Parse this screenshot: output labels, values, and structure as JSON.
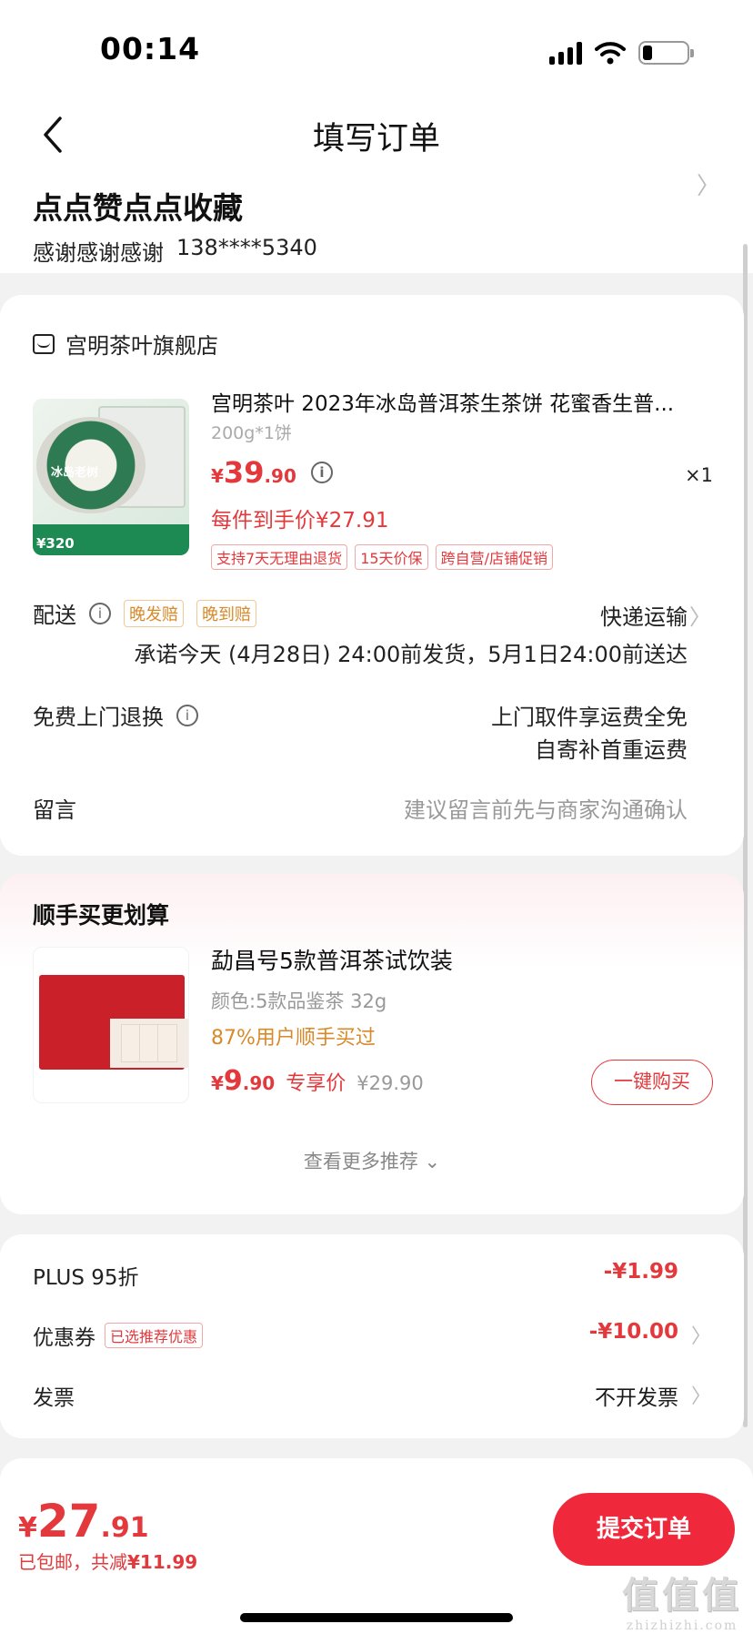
{
  "status_bar": {
    "time": "00:14"
  },
  "nav": {
    "title": "填写订单"
  },
  "address": {
    "name": "点点赞点点收藏",
    "contact_name": "感谢感谢感谢",
    "phone": "138****5340"
  },
  "shop": {
    "name": "宫明茶叶旗舰店"
  },
  "product": {
    "title": "宫明茶叶 2023年冰岛普洱茶生茶饼 花蜜香生普...",
    "spec": "200g*1饼",
    "price_yen": "¥",
    "price_int": "39",
    "price_dec": ".90",
    "quantity": "×1",
    "unit_price": "每件到手价¥27.91",
    "tags": [
      "支持7天无理由退货",
      "15天价保",
      "跨自营/店铺促销"
    ],
    "image_text": {
      "label": "冰岛老树",
      "price": "¥320"
    }
  },
  "delivery": {
    "label": "配送",
    "tags": [
      "晚发赔",
      "晚到赔"
    ],
    "method": "快递运输",
    "promise": "承诺今天 (4月28日) 24:00前发货，5月1日24:00前送达"
  },
  "return_service": {
    "label": "免费上门退换",
    "line1": "上门取件享运费全免",
    "line2": "自寄补首重运费"
  },
  "message": {
    "label": "留言",
    "placeholder": "建议留言前先与商家沟通确认"
  },
  "recommend": {
    "title": "顺手买更划算",
    "item": {
      "title": "勐昌号5款普洱茶试饮装",
      "spec": "颜色:5款品鉴茶 32g",
      "social": "87%用户顺手买过",
      "price_yen": "¥",
      "price_int": "9",
      "price_dec": ".90",
      "price_label": "专享价",
      "original_price": "¥29.90",
      "buy_label": "一键购买"
    },
    "more_label": "查看更多推荐 ⌄"
  },
  "discounts": [
    {
      "label": "PLUS 95折",
      "value": "-¥1.99"
    },
    {
      "label": "优惠券",
      "tag": "已选推荐优惠",
      "value": "-¥10.00"
    },
    {
      "label": "发票",
      "value": "不开发票"
    }
  ],
  "footer": {
    "total_yen": "¥",
    "total_int": "27",
    "total_dec": ".91",
    "shipping_text": "已包邮，共减",
    "savings_amount": "¥11.99",
    "submit_label": "提交订单",
    "watermark": "值值值",
    "watermark_url": "zhizhizhi.com"
  },
  "colors": {
    "accent_red": "#e4393c",
    "submit_red": "#f0283c",
    "orange": "#d88a2a",
    "background": "#f2f2f2"
  }
}
